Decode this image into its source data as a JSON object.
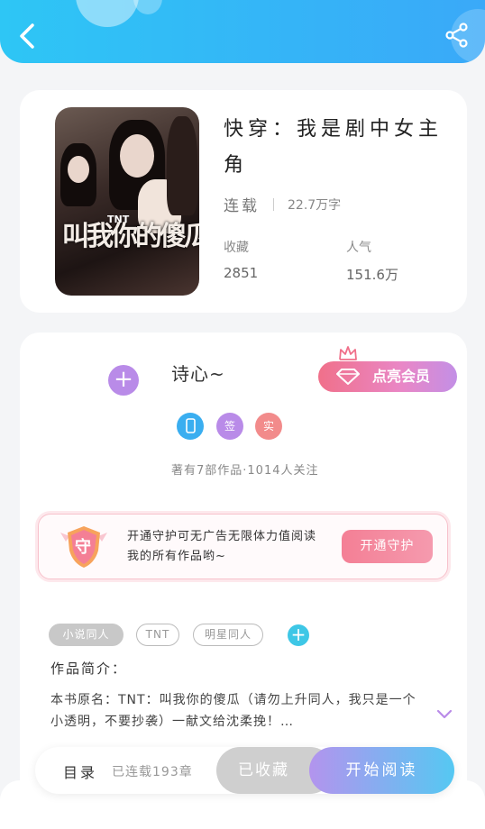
{
  "header": {
    "back_icon": "chevron-left-icon",
    "share_icon": "share-icon"
  },
  "book": {
    "title": "快穿：我是剧中女主角",
    "status": "连载",
    "word_count": "22.7万字",
    "collect_label": "收藏",
    "collect_value": "2851",
    "popularity_label": "人气",
    "popularity_value": "151.6万",
    "cover_title": "叫我你的傻瓜",
    "cover_sub": "TNT"
  },
  "author": {
    "name": "诗心~",
    "vip_label": "点亮会员",
    "badges": [
      {
        "text": "",
        "color": "#3aaef0"
      },
      {
        "text": "签",
        "color": "#b98be8"
      },
      {
        "text": "实",
        "color": "#f28b8b"
      }
    ],
    "followers": "著有7部作品·1014人关注"
  },
  "guard": {
    "shield_text": "守",
    "text": "开通守护可无广告无限体力值阅读我的所有作品哟~",
    "button": "开通守护"
  },
  "tags": [
    "小说同人",
    "TNT",
    "明星同人"
  ],
  "intro": {
    "title": "作品简介：",
    "text": "本书原名：TNT：叫我你的傻瓜（请勿上升同人，我只是一个小透明，不要抄袭）一献文给沈柔挽！…"
  },
  "bottom_bar": {
    "toc_label": "目录",
    "chapter_count": "已连载193章",
    "collected": "已收藏",
    "start_read": "开始阅读"
  },
  "colors": {
    "header": "#35b4f7",
    "vip": "#f0708a",
    "guard_button": "#f47f95",
    "read_button": "#55c8f2"
  }
}
